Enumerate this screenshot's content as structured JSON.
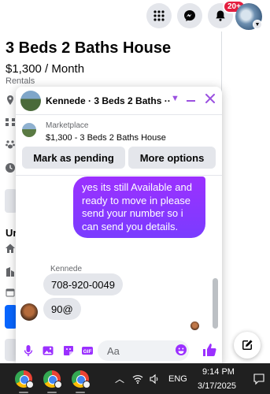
{
  "topnav": {
    "notifications_badge": "20+"
  },
  "listing": {
    "title": "3 Beds 2 Baths House",
    "price": "$1,300 / Month",
    "category": "Rentals",
    "partial_text": "Ur"
  },
  "chat": {
    "header_title": "Kennede · 3 Beds 2 Baths ···",
    "marketplace_label": "Marketplace",
    "marketplace_item": "$1,300 - 3 Beds 2 Baths House",
    "mark_pending": "Mark as pending",
    "more_options": "More options",
    "messages": [
      {
        "from": "me",
        "text": "yes its still Available and ready to move in please send your number so i can send you details."
      },
      {
        "from": "them",
        "sender": "Kennede",
        "text": "708-920-0049"
      },
      {
        "from": "them",
        "text": "90@"
      }
    ],
    "composer_placeholder": "Aa"
  },
  "taskbar": {
    "language": "ENG",
    "time": "9:14 PM",
    "date": "3/17/2025"
  },
  "colors": {
    "accent_purple": "#9b30ff",
    "facebook_blue": "#0866ff",
    "badge_red": "#e41e3f"
  }
}
